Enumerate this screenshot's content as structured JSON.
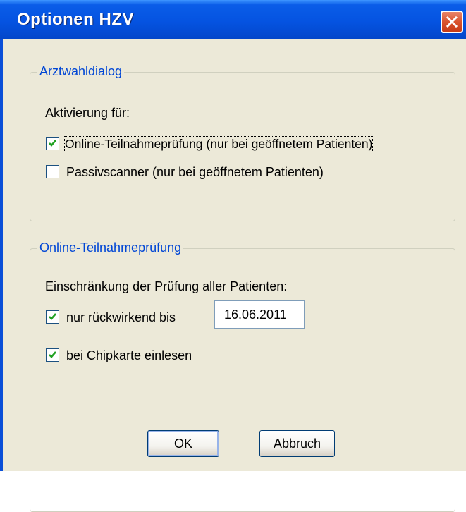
{
  "window": {
    "title": "Optionen HZV"
  },
  "arztwahl": {
    "legend": "Arztwahldialog",
    "activation_label": "Aktivierung für:",
    "online_check": {
      "label": "Online-Teilnahmeprüfung (nur bei geöffnetem Patienten)",
      "checked": true
    },
    "passive_scanner": {
      "label": "Passivscanner (nur bei geöffnetem Patienten)",
      "checked": false
    }
  },
  "online": {
    "legend": "Online-Teilnahmeprüfung",
    "restriction_label": "Einschränkung der Prüfung aller Patienten:",
    "retroactive": {
      "label": "nur rückwirkend bis",
      "checked": true,
      "date": "16.06.2011"
    },
    "chipcard": {
      "label": "bei Chipkarte einlesen",
      "checked": true
    }
  },
  "buttons": {
    "ok": "OK",
    "cancel": "Abbruch"
  },
  "colors": {
    "titlebar": "#0553E1",
    "groupbox_legend": "#0046D5",
    "dialog_bg": "#ECE9D8"
  },
  "icons": {
    "close": "close-icon",
    "check": "checkmark-icon"
  }
}
